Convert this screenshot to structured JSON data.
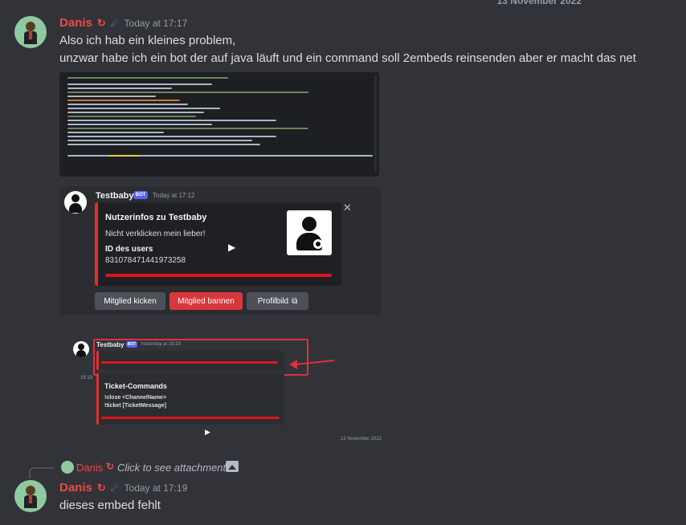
{
  "date_divider": "13 November 2022",
  "message1": {
    "author": "Danis",
    "sub_icon": "↻",
    "role_icon": "☄",
    "timestamp": "Today at 17:17",
    "lines": [
      "Also ich hab ein kleines problem,",
      "unzwar habe ich ein bot der auf java läuft und ein command soll 2embeds reinsenden aber er macht das net"
    ]
  },
  "embed_screenshot": {
    "bot_name": "Testbaby",
    "bot_tag": "BOT",
    "timestamp": "Today at 17:12",
    "title": "Nutzerinfos zu Testbaby",
    "description": "Nicht verklicken mein lieber!",
    "field_name": "ID des users",
    "field_value": "831078471441973258",
    "close_icon": "✕",
    "buttons": [
      {
        "label": "Mitglied kicken",
        "style": "grey"
      },
      {
        "label": "Mitglied bannen",
        "style": "red"
      },
      {
        "label": "Profilbild",
        "style": "grey",
        "icon": "⧉"
      }
    ],
    "accent_color": "#e0302f",
    "bar_color": "#e0141c"
  },
  "ticket_screenshot": {
    "bot_name": "Testbaby",
    "bot_tag": "BOT",
    "timestamp": "Yesterday at 19:19",
    "side_time": "19:19",
    "title": "Ticket-Commands",
    "commands": [
      "!close <ChannelName>",
      "!ticket [TicketMessage]"
    ],
    "date_footer": "13 November 2022"
  },
  "reply": {
    "author": "Danis",
    "sub_icon": "↻",
    "text": "Click to see attachment"
  },
  "message2": {
    "author": "Danis",
    "sub_icon": "↻",
    "role_icon": "☄",
    "timestamp": "Today at 17:19",
    "text": "dieses embed fehlt"
  }
}
